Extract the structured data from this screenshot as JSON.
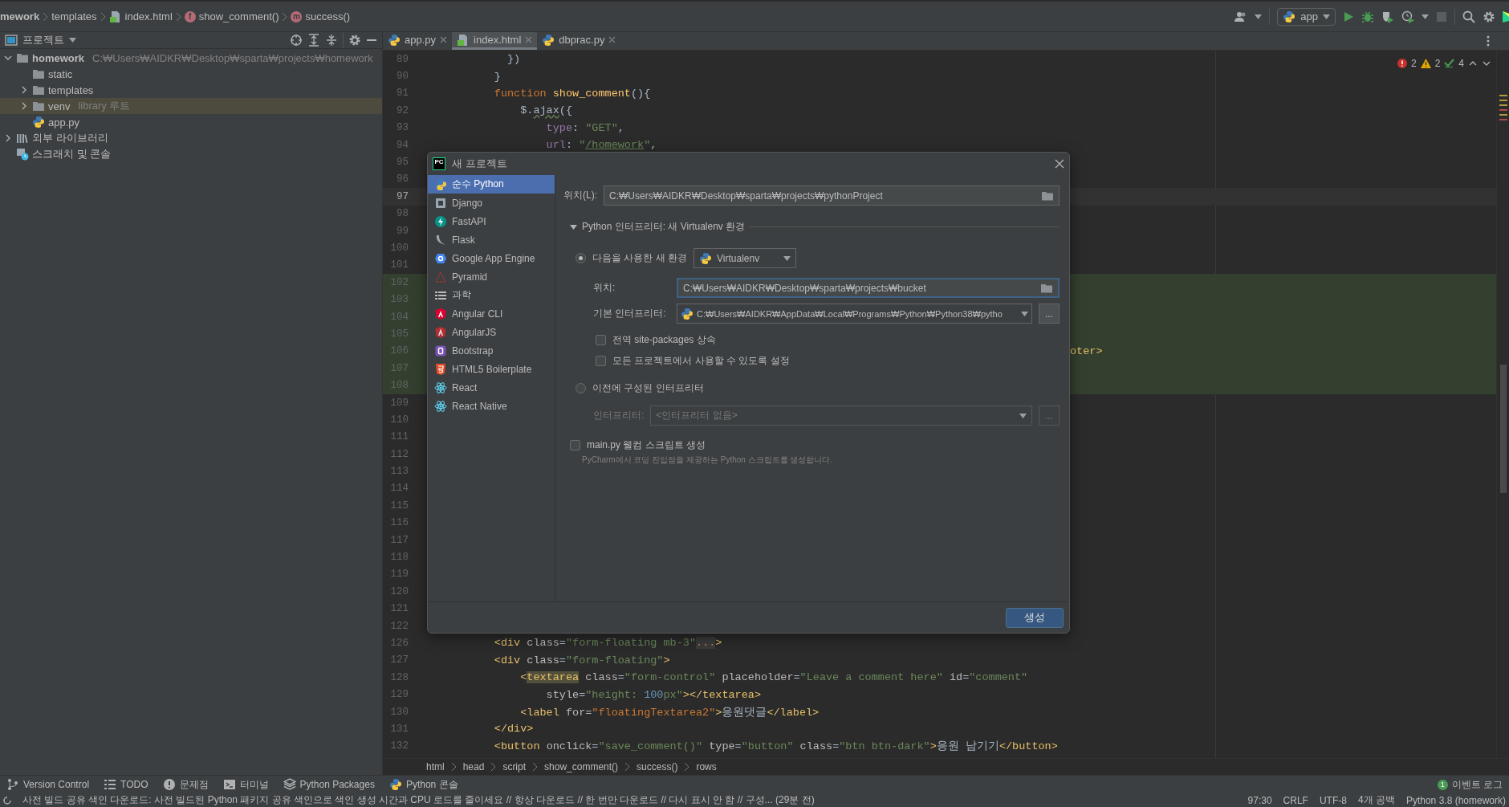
{
  "navbar": {
    "breadcrumbs": [
      {
        "label": "mework",
        "kind": "folder"
      },
      {
        "label": "templates",
        "kind": "folder"
      },
      {
        "label": "index.html",
        "kind": "html"
      },
      {
        "label": "show_comment()",
        "kind": "function",
        "badge": "f"
      },
      {
        "label": "success()",
        "kind": "method",
        "badge": "m"
      }
    ],
    "run_config": "app"
  },
  "project_panel": {
    "title": "프로젝트",
    "tree": [
      {
        "label": "homework",
        "path": "C:₩Users₩AIDKR₩Desktop₩sparta₩projects₩homework",
        "kind": "folder",
        "expanded": true,
        "selected": false,
        "children": [
          {
            "label": "static",
            "kind": "folder",
            "selected": false
          },
          {
            "label": "templates",
            "kind": "folder",
            "expanded": false,
            "selected": false
          },
          {
            "label": "venv",
            "note": "library 루트",
            "kind": "folder",
            "expanded": false,
            "selected": true
          },
          {
            "label": "app.py",
            "kind": "python",
            "selected": false
          }
        ]
      },
      {
        "label": "외부 라이브러리",
        "kind": "library",
        "expanded": false,
        "selected": false
      },
      {
        "label": "스크래치 및 콘솔",
        "kind": "scratch",
        "selected": false
      }
    ]
  },
  "editor": {
    "tabs": [
      {
        "label": "app.py",
        "kind": "python",
        "selected": false
      },
      {
        "label": "index.html",
        "kind": "html",
        "selected": true
      },
      {
        "label": "dbprac.py",
        "kind": "python",
        "selected": false
      }
    ],
    "inspections": {
      "errors": "2",
      "warnings": "2",
      "typos": "4"
    },
    "lines": [
      {
        "n": "89",
        "kind": "plain",
        "segs": [
          {
            "kind": "p",
            "t": "          })"
          }
        ]
      },
      {
        "n": "90",
        "kind": "plain",
        "segs": [
          {
            "kind": "p",
            "t": "        }"
          }
        ]
      },
      {
        "n": "91",
        "kind": "plain",
        "segs": [
          {
            "kind": "kw",
            "t": "        function "
          },
          {
            "kind": "fn",
            "t": "show_comment"
          },
          {
            "kind": "p",
            "t": "(){"
          }
        ]
      },
      {
        "n": "92",
        "kind": "plain",
        "segs": [
          {
            "kind": "p",
            "t": "            $."
          },
          {
            "kind": "wavy",
            "t": "ajax"
          },
          {
            "kind": "p",
            "t": "({"
          }
        ]
      },
      {
        "n": "93",
        "kind": "plain",
        "segs": [
          {
            "kind": "prop",
            "t": "                type"
          },
          {
            "kind": "p",
            "t": ": "
          },
          {
            "kind": "str",
            "t": "\"GET\""
          },
          {
            "kind": "p",
            "t": ","
          }
        ]
      },
      {
        "n": "94",
        "kind": "plain",
        "segs": [
          {
            "kind": "prop",
            "t": "                url"
          },
          {
            "kind": "p",
            "t": ": "
          },
          {
            "kind": "str",
            "t": "\""
          },
          {
            "kind": "link",
            "t": "/homework"
          },
          {
            "kind": "str",
            "t": "\""
          },
          {
            "kind": "p",
            "t": ","
          }
        ]
      },
      {
        "n": "95",
        "kind": "plain"
      },
      {
        "n": "96",
        "kind": "plain"
      },
      {
        "n": "97",
        "kind": "current"
      },
      {
        "n": "98",
        "kind": "plain"
      },
      {
        "n": "99",
        "kind": "plain"
      },
      {
        "n": "100",
        "kind": "plain"
      },
      {
        "n": "101",
        "kind": "plain"
      },
      {
        "n": "102",
        "kind": "changed"
      },
      {
        "n": "103",
        "kind": "changed"
      },
      {
        "n": "104",
        "kind": "changed"
      },
      {
        "n": "105",
        "kind": "changed"
      },
      {
        "n": "106",
        "kind": "changed",
        "segs_right": [
          {
            "kind": "tag",
            "t": "oter>"
          }
        ]
      },
      {
        "n": "107",
        "kind": "changed"
      },
      {
        "n": "108",
        "kind": "changed"
      },
      {
        "n": "109",
        "kind": "plain"
      },
      {
        "n": "110",
        "kind": "plain"
      },
      {
        "n": "111",
        "kind": "plain"
      },
      {
        "n": "112",
        "kind": "plain"
      },
      {
        "n": "113",
        "kind": "plain"
      },
      {
        "n": "114",
        "kind": "plain"
      },
      {
        "n": "115",
        "kind": "plain"
      },
      {
        "n": "116",
        "kind": "plain"
      },
      {
        "n": "117",
        "kind": "plain"
      },
      {
        "n": "118",
        "kind": "plain"
      },
      {
        "n": "119",
        "kind": "plain"
      },
      {
        "n": "120",
        "kind": "plain"
      },
      {
        "n": "121",
        "kind": "plain"
      },
      {
        "n": "122",
        "kind": "plain"
      },
      {
        "n": "126",
        "kind": "plain",
        "segs": [
          {
            "kind": "tag",
            "t": "        <div "
          },
          {
            "kind": "attr",
            "t": "class"
          },
          {
            "kind": "p",
            "t": "="
          },
          {
            "kind": "str",
            "t": "\"form-floating mb-3\""
          },
          {
            "kind": "fold",
            "t": "..."
          },
          {
            "kind": "tag",
            "t": ">"
          }
        ]
      },
      {
        "n": "127",
        "kind": "plain",
        "segs": [
          {
            "kind": "tag",
            "t": "        <div "
          },
          {
            "kind": "attr",
            "t": "class"
          },
          {
            "kind": "p",
            "t": "="
          },
          {
            "kind": "str",
            "t": "\"form-floating\""
          },
          {
            "kind": "tag",
            "t": ">"
          }
        ]
      },
      {
        "n": "128",
        "kind": "plain",
        "segs": [
          {
            "kind": "tag",
            "t": "            <"
          },
          {
            "kind": "taghl",
            "t": "textarea"
          },
          {
            "kind": "attr",
            "t": " class"
          },
          {
            "kind": "p",
            "t": "="
          },
          {
            "kind": "str",
            "t": "\"form-control\""
          },
          {
            "kind": "attr",
            "t": " placeholder"
          },
          {
            "kind": "p",
            "t": "="
          },
          {
            "kind": "str",
            "t": "\"Leave a comment here\""
          },
          {
            "kind": "attr",
            "t": " id"
          },
          {
            "kind": "p",
            "t": "="
          },
          {
            "kind": "str",
            "t": "\"comment\""
          }
        ]
      },
      {
        "n": "129",
        "kind": "plain",
        "segs": [
          {
            "kind": "attr",
            "t": "                style"
          },
          {
            "kind": "p",
            "t": "="
          },
          {
            "kind": "str",
            "t": "\"height: "
          },
          {
            "kind": "num",
            "t": "100"
          },
          {
            "kind": "str",
            "t": "px\""
          },
          {
            "kind": "tag",
            "t": "></textarea>"
          }
        ]
      },
      {
        "n": "130",
        "kind": "plain",
        "segs": [
          {
            "kind": "tag",
            "t": "            <label "
          },
          {
            "kind": "attr",
            "t": "for"
          },
          {
            "kind": "p",
            "t": "="
          },
          {
            "kind": "err",
            "t": "\"floatingTextarea2\""
          },
          {
            "kind": "tag",
            "t": ">"
          },
          {
            "kind": "p",
            "t": "응원댓글"
          },
          {
            "kind": "tag",
            "t": "</label>"
          }
        ]
      },
      {
        "n": "131",
        "kind": "plain",
        "segs": [
          {
            "kind": "tag",
            "t": "        </div>"
          }
        ]
      },
      {
        "n": "132",
        "kind": "plain",
        "segs": [
          {
            "kind": "tag",
            "t": "        <button "
          },
          {
            "kind": "attr",
            "t": "onclick"
          },
          {
            "kind": "p",
            "t": "="
          },
          {
            "kind": "str",
            "t": "\"save_comment()\""
          },
          {
            "kind": "attr",
            "t": " type"
          },
          {
            "kind": "p",
            "t": "="
          },
          {
            "kind": "str",
            "t": "\"button\""
          },
          {
            "kind": "attr",
            "t": " class"
          },
          {
            "kind": "p",
            "t": "="
          },
          {
            "kind": "str",
            "t": "\"btn btn-dark\""
          },
          {
            "kind": "tag",
            "t": ">"
          },
          {
            "kind": "p",
            "t": "응원 남기기"
          },
          {
            "kind": "tag",
            "t": "</button>"
          }
        ]
      }
    ],
    "breadcrumbs": [
      "html",
      "head",
      "script",
      "show_comment()",
      "success()",
      "rows"
    ]
  },
  "dialog": {
    "logo": "PC",
    "title": "새 프로젝트",
    "project_types": [
      {
        "label": "순수 Python",
        "kind": "python",
        "selected": true
      },
      {
        "label": "Django",
        "kind": "django",
        "selected": false
      },
      {
        "label": "FastAPI",
        "kind": "fastapi",
        "selected": false
      },
      {
        "label": "Flask",
        "kind": "flask",
        "selected": false
      },
      {
        "label": "Google App Engine",
        "kind": "gae",
        "selected": false
      },
      {
        "label": "Pyramid",
        "kind": "pyramid",
        "selected": false
      },
      {
        "label": "과학",
        "kind": "science",
        "selected": false
      },
      {
        "label": "Angular CLI",
        "kind": "angular",
        "selected": false
      },
      {
        "label": "AngularJS",
        "kind": "angularjs",
        "selected": false
      },
      {
        "label": "Bootstrap",
        "kind": "bootstrap",
        "selected": false
      },
      {
        "label": "HTML5 Boilerplate",
        "kind": "html5",
        "selected": false
      },
      {
        "label": "React",
        "kind": "react",
        "selected": false
      },
      {
        "label": "React Native",
        "kind": "react",
        "selected": false
      }
    ],
    "location_label": "위치(L):",
    "location": "C:₩Users₩AIDKR₩Desktop₩sparta₩projects₩pythonProject",
    "interpreter_section": {
      "label": "Python 인터프리터: 새 Virtualenv 환경",
      "expanded": true
    },
    "new_env": {
      "label": "다음을 사용한 새 환경",
      "selected": true,
      "tool": "Virtualenv",
      "location_label": "위치:",
      "location": "C:₩Users₩AIDKR₩Desktop₩sparta₩projects₩bucket",
      "base_label": "기본 인터프리터:",
      "base": "C:₩Users₩AIDKR₩AppData₩Local₩Programs₩Python₩Python38₩pytho",
      "browse": "...",
      "options": [
        {
          "label": "전역 site-packages 상속",
          "checked": false
        },
        {
          "label": "모든 프로젝트에서 사용할 수 있도록 설정",
          "checked": false
        }
      ]
    },
    "existing": {
      "label": "이전에 구성된 인터프리터",
      "selected": false,
      "interpreter_label": "인터프리터:",
      "interpreter": "<인터프리터 없음>",
      "browse": "...",
      "disabled": true
    },
    "welcome_script": {
      "label": "main.py 웰컴 스크립트 생성",
      "checked": false,
      "hint": "PyCharm에서 코딩 진입점을 제공하는 Python 스크립트를 생성합니다."
    },
    "create_button": "생성"
  },
  "tool_windows": [
    {
      "label": "Version Control",
      "kind": "vcs"
    },
    {
      "label": "TODO",
      "kind": "todo"
    },
    {
      "label": "문제점",
      "kind": "problems"
    },
    {
      "label": "터미널",
      "kind": "terminal"
    },
    {
      "label": "Python Packages",
      "kind": "packages"
    },
    {
      "label": "Python 콘솔",
      "kind": "console"
    }
  ],
  "event_log": {
    "count": "1",
    "label": "이벤트 로그"
  },
  "status_bar": {
    "message": "사전 빌드 공유 색인 다운로드: 사전 빌드된 Python 패키지 공유 색인으로 색인 생성 시간과 CPU 로드를 줄이세요 // 항상 다운로드 // 한 번만 다운로드 // 다시 표시 안 함 // 구성... (29분 전)",
    "items": [
      "97:30",
      "CRLF",
      "UTF-8",
      "4개 공백",
      "Python 3.8 (homework)"
    ]
  }
}
